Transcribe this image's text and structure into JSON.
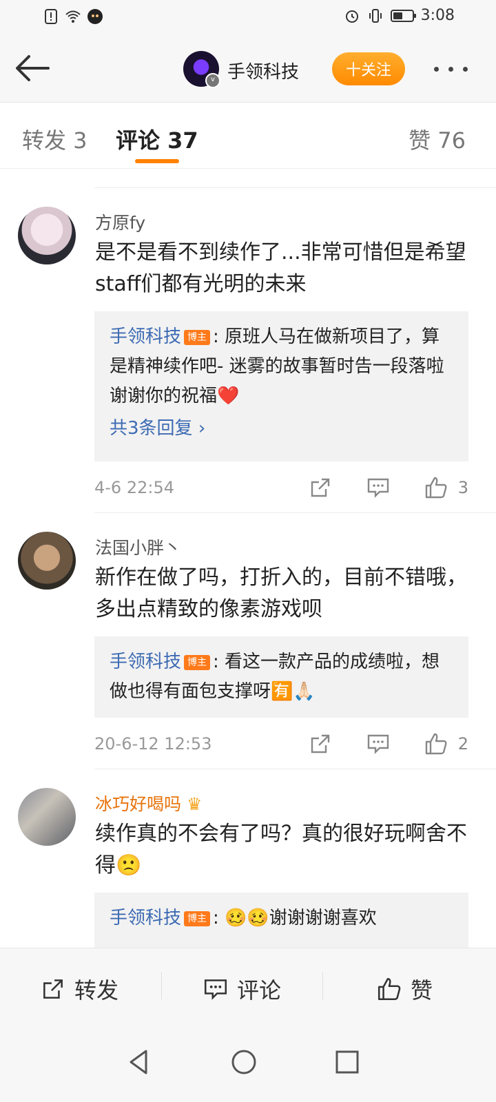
{
  "status_bar": {
    "time": "3:08"
  },
  "header": {
    "account_name": "手领科技",
    "follow_label": "十关注"
  },
  "tabs": {
    "repost": "转发 3",
    "comments": "评论 37",
    "likes": "赞 76"
  },
  "comments": [
    {
      "username": "方原fy",
      "text": "是不是看不到续作了...非常可惜但是希望staff们都有光明的未来",
      "reply": {
        "author": "手领科技",
        "badge": "博主",
        "text": "原班人马在做新项目了，算是精神续作吧- 迷雾的故事暂时告一段落啦 谢谢你的祝福❤️"
      },
      "more_replies": "共3条回复",
      "date": "4-6 22:54",
      "likes": "3"
    },
    {
      "username": "法国小胖丶",
      "text": "新作在做了吗，打折入的，目前不错哦，多出点精致的像素游戏呗",
      "reply": {
        "author": "手领科技",
        "badge": "博主",
        "text": "看这一款产品的成绩啦，想做也得有面包支撑呀🈶🙏🏻"
      },
      "date": "20-6-12 12:53",
      "likes": "2"
    },
    {
      "username": "冰巧好喝吗",
      "text": "续作真的不会有了吗？真的很好玩啊舍不得🙁",
      "reply": {
        "author": "手领科技",
        "badge": "博主",
        "text": "🥴🥴谢谢谢谢喜欢"
      }
    }
  ],
  "bottom_bar": {
    "repost": "转发",
    "comment": "评论",
    "like": "赞"
  },
  "colors": {
    "accent": "#ff8200",
    "link_blue": "#3d6bb3",
    "vip_orange": "#e8730b"
  }
}
